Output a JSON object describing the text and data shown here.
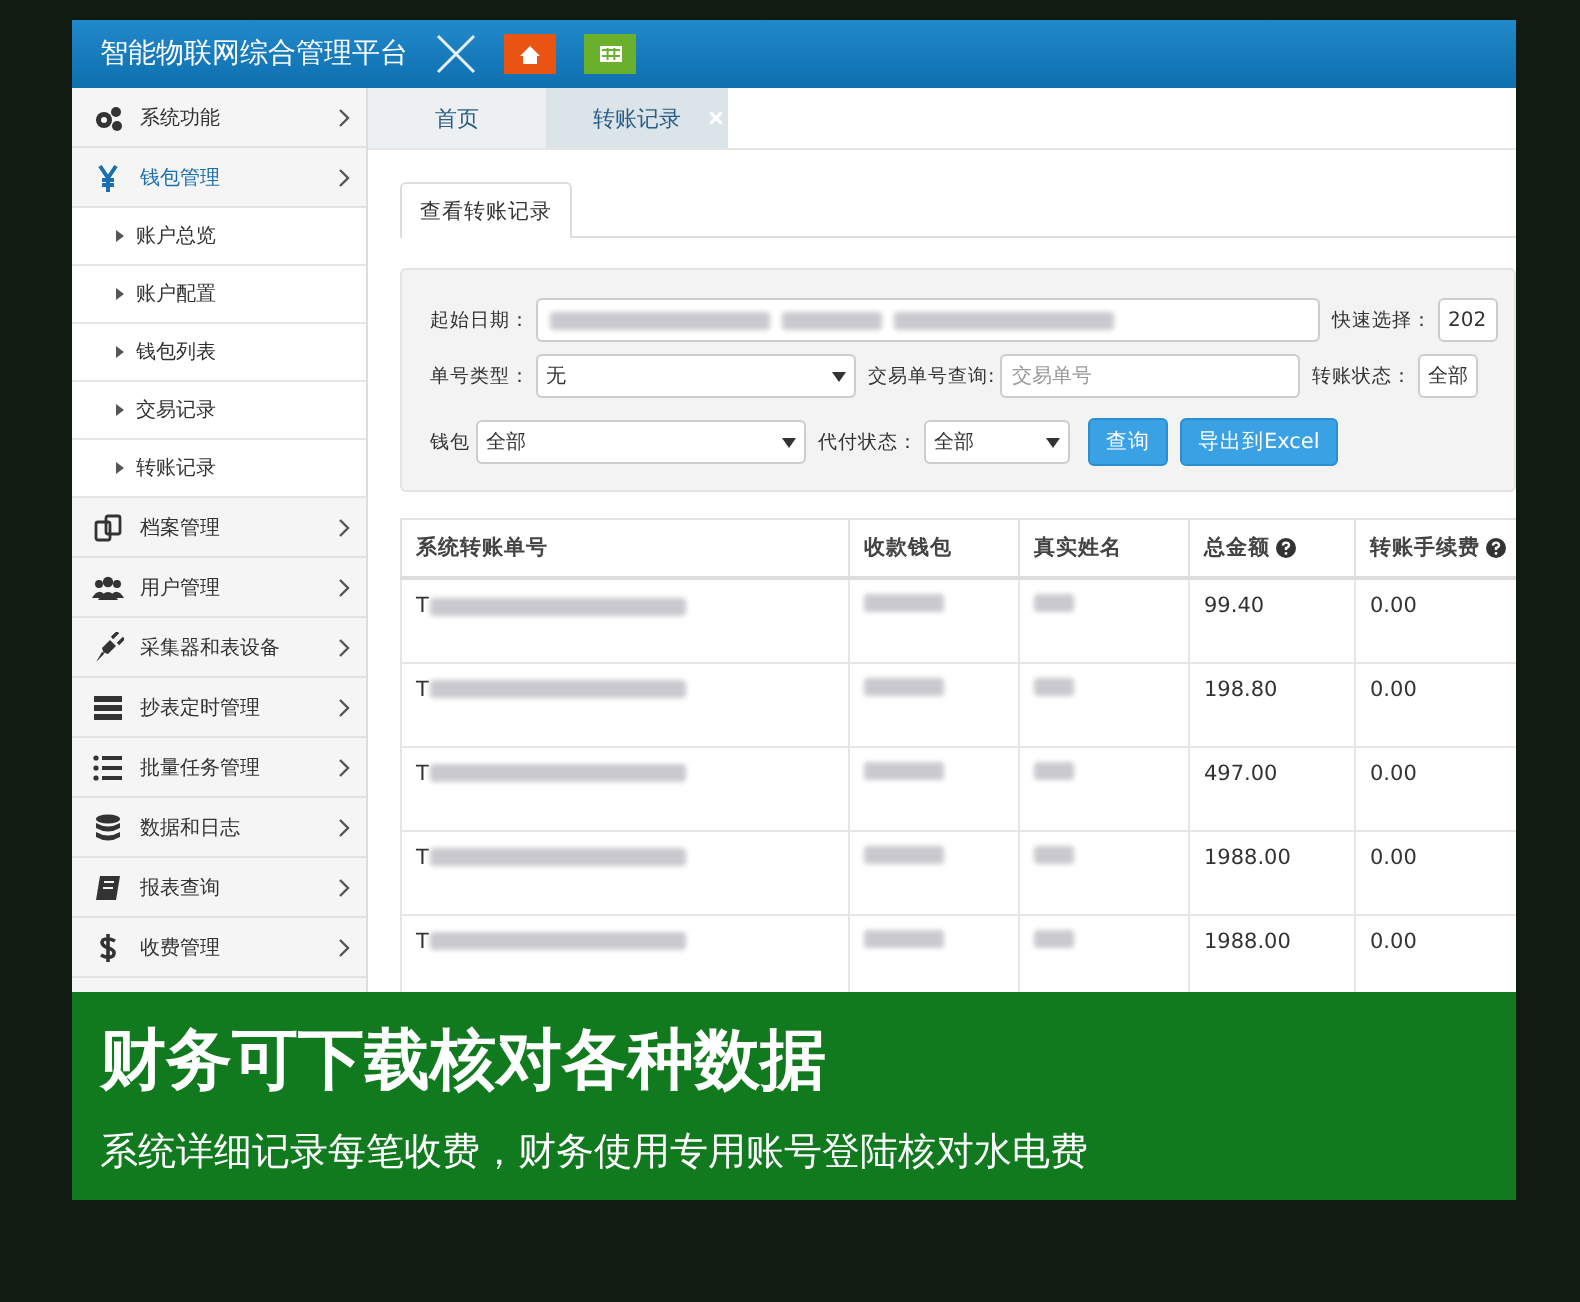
{
  "header": {
    "title": "智能物联网综合管理平台"
  },
  "sidebar": {
    "items": [
      {
        "label": "系统功能",
        "kind": "gears",
        "expanded": false
      },
      {
        "label": "钱包管理",
        "kind": "yen",
        "expanded": true,
        "children": [
          {
            "label": "账户总览"
          },
          {
            "label": "账户配置"
          },
          {
            "label": "钱包列表"
          },
          {
            "label": "交易记录"
          },
          {
            "label": "转账记录"
          }
        ]
      },
      {
        "label": "档案管理",
        "kind": "files",
        "expanded": false
      },
      {
        "label": "用户管理",
        "kind": "users",
        "expanded": false
      },
      {
        "label": "采集器和表设备",
        "kind": "plug",
        "expanded": false
      },
      {
        "label": "抄表定时管理",
        "kind": "bars",
        "expanded": false
      },
      {
        "label": "批量任务管理",
        "kind": "list",
        "expanded": false
      },
      {
        "label": "数据和日志",
        "kind": "database",
        "expanded": false
      },
      {
        "label": "报表查询",
        "kind": "book",
        "expanded": false
      },
      {
        "label": "收费管理",
        "kind": "dollar",
        "expanded": false
      }
    ]
  },
  "tabs": [
    {
      "label": "首页",
      "selected": false,
      "closable": false
    },
    {
      "label": "转账记录",
      "selected": true,
      "closable": true
    }
  ],
  "subtabs": [
    {
      "label": "查看转账记录",
      "selected": true
    }
  ],
  "form": {
    "rows": [
      [
        {
          "kind": "daterange",
          "label": "起始日期："
        },
        {
          "kind": "select",
          "label": "快速选择：",
          "value": "202"
        }
      ],
      [
        {
          "kind": "select",
          "label": "单号类型：",
          "value": "无"
        },
        {
          "kind": "input",
          "label": "交易单号查询:",
          "placeholder": "交易单号"
        },
        {
          "kind": "select",
          "label": "转账状态：",
          "value": "全部"
        }
      ],
      [
        {
          "kind": "select",
          "label": "钱包",
          "value": "全部"
        },
        {
          "kind": "select",
          "label": "代付状态：",
          "value": "全部"
        },
        {
          "kind": "button",
          "label": "查询"
        },
        {
          "kind": "button",
          "label": "导出到Excel"
        }
      ]
    ]
  },
  "table": {
    "columns": [
      {
        "label": "系统转账单号",
        "help": false
      },
      {
        "label": "收款钱包",
        "help": false
      },
      {
        "label": "真实姓名",
        "help": false
      },
      {
        "label": "总金额",
        "help": true
      },
      {
        "label": "转账手续费",
        "help": true
      }
    ],
    "rows": [
      {
        "order": "T",
        "total": "99.40",
        "fee": "0.00"
      },
      {
        "order": "T",
        "total": "198.80",
        "fee": "0.00"
      },
      {
        "order": "T",
        "total": "497.00",
        "fee": "0.00"
      },
      {
        "order": "T",
        "total": "1988.00",
        "fee": "0.00"
      },
      {
        "order": "T",
        "total": "1988.00",
        "fee": "0.00"
      }
    ]
  },
  "banner": {
    "title": "财务可下载核对各种数据",
    "subtitle": "系统详细记录每笔收费，财务使用专用账号登陆核对水电费"
  }
}
